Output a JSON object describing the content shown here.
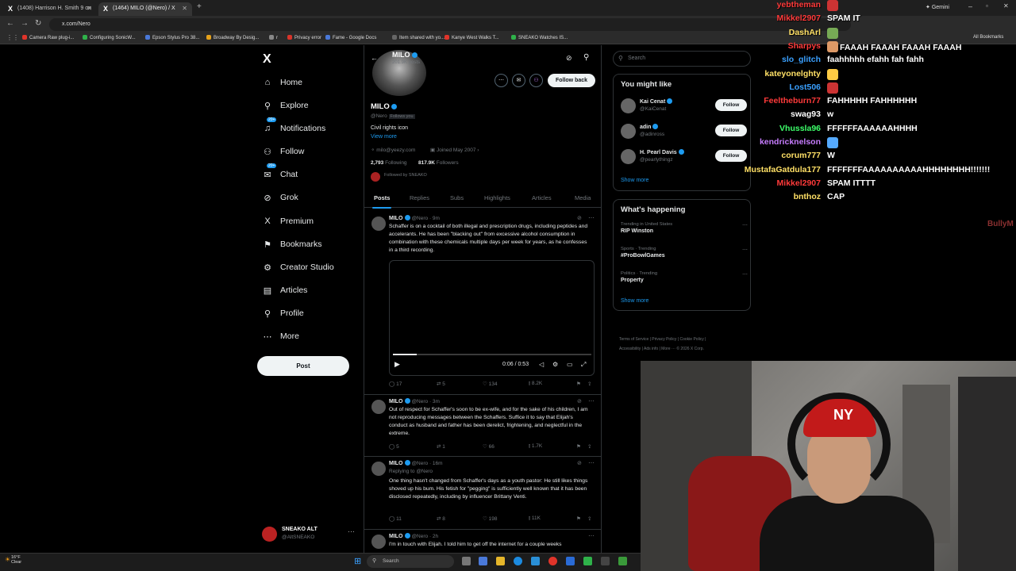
{
  "browser": {
    "tabs": [
      {
        "title": "(1408) Harrison H. Smith 9 on"
      },
      {
        "title": "(1464) MILO (@Nero) / X"
      }
    ],
    "new_tab_icon": "+",
    "url": "x.com/Nero",
    "gemini_label": "Gemini",
    "bookmarks": [
      {
        "label": "Camera Raw plug-i...",
        "color": "#e0342a"
      },
      {
        "label": "Configuring SonicW...",
        "color": "#2fb24a"
      },
      {
        "label": "Epson Stylus Pro 38...",
        "color": "#4a79d9"
      },
      {
        "label": "Broadway By Desig...",
        "color": "#e6a21a"
      },
      {
        "label": "r",
        "color": "#888888"
      },
      {
        "label": "Privacy error",
        "color": "#d9342a"
      },
      {
        "label": "Fame - Google Docs",
        "color": "#4a79d9"
      },
      {
        "label": "Item shared with yo...",
        "color": "#666666"
      },
      {
        "label": "Kanye West Walks T...",
        "color": "#e0342a"
      },
      {
        "label": "SNEAKO Watches IS...",
        "color": "#2fb24a"
      }
    ],
    "all_bookmarks": "All Bookmarks"
  },
  "nav": {
    "items": [
      {
        "label": "Home",
        "icon": "home-icon",
        "glyph": "⌂"
      },
      {
        "label": "Explore",
        "icon": "search-icon",
        "glyph": "⚲"
      },
      {
        "label": "Notifications",
        "icon": "bell-icon",
        "glyph": "♫",
        "badge": "20+"
      },
      {
        "label": "Follow",
        "icon": "add-user-icon",
        "glyph": "⚇"
      },
      {
        "label": "Chat",
        "icon": "mail-icon",
        "glyph": "✉",
        "badge": "20+"
      },
      {
        "label": "Grok",
        "icon": "grok-icon",
        "glyph": "⊘"
      },
      {
        "label": "Premium",
        "icon": "x-icon",
        "glyph": "X"
      },
      {
        "label": "Bookmarks",
        "icon": "bookmark-icon",
        "glyph": "⚑"
      },
      {
        "label": "Creator Studio",
        "icon": "studio-icon",
        "glyph": "⚙"
      },
      {
        "label": "Articles",
        "icon": "articles-icon",
        "glyph": "▤"
      },
      {
        "label": "Profile",
        "icon": "person-icon",
        "glyph": "⚲"
      },
      {
        "label": "More",
        "icon": "more-icon",
        "glyph": "⋯"
      }
    ],
    "post_label": "Post",
    "account": {
      "name": "SNEAKO ALT",
      "handle": "@AltSNEAKO"
    }
  },
  "profile": {
    "header_name": "MILO",
    "header_posts": "201.9K posts",
    "name": "MILO",
    "handle": "@Nero",
    "follows_you": "Follows you",
    "bio": "Civil rights icon",
    "view_more": "View more",
    "email": "milo@yeezy.com",
    "joined": "Joined May 2007",
    "following_count": "2,793",
    "following_label": "Following",
    "followers_count": "817.9K",
    "followers_label": "Followers",
    "followed_by": "Followed by SNEAKO",
    "follow_back": "Follow back",
    "tabs": [
      "Posts",
      "Replies",
      "Subs",
      "Highlights",
      "Articles",
      "Media"
    ]
  },
  "tweets": [
    {
      "name": "MILO",
      "handle": "@Nero",
      "time": "9m",
      "reply_to": "",
      "text": "Schaffer is on a cocktail of both illegal and prescription drugs, including peptides and accelerants. He has been \"blacking out\" from excessive alcohol consumption in combination with these chemicals multiple days per week for years, as he confesses in a third recording.",
      "video_time": "0:06 / 0:53",
      "replies": "17",
      "reposts": "5",
      "likes": "134",
      "views": "8.2K"
    },
    {
      "name": "MILO",
      "handle": "@Nero",
      "time": "3m",
      "reply_to": "",
      "text": "Out of respect for Schaffer's soon to be ex-wife, and for the sake of his children, I am not reproducing messages between the Schaffers. Suffice it to say that Elijah's conduct as husband and father has been derelict, frightening, and neglectful in the extreme.",
      "replies": "5",
      "reposts": "1",
      "likes": "66",
      "views": "1.7K"
    },
    {
      "name": "MILO",
      "handle": "@Nero",
      "time": "16m",
      "reply_to": "Replying to @Nero",
      "text": "One thing hasn't changed from Schaffer's days as a youth pastor: He still likes things shoved up his bum. His fetish for \"pegging\" is sufficiently well known that it has been disclosed repeatedly, including by influencer Brittany Venti.",
      "replies": "11",
      "reposts": "8",
      "likes": "198",
      "views": "11K"
    },
    {
      "name": "MILO",
      "handle": "@Nero",
      "time": "2h",
      "reply_to": "",
      "text": "I'm in touch with Elijah. I told him to get off the internet for a couple weeks"
    }
  ],
  "sidebar": {
    "search_placeholder": "Search",
    "you_might_like": "You might like",
    "suggestions": [
      {
        "name": "Kai Cenat",
        "handle": "@KaiCenat",
        "follow": "Follow"
      },
      {
        "name": "adin",
        "handle": "@adinross",
        "follow": "Follow"
      },
      {
        "name": "H. Pearl Davis",
        "handle": "@pearlythingz",
        "follow": "Follow"
      }
    ],
    "show_more": "Show more",
    "whats_happening": "What's happening",
    "trends": [
      {
        "category": "Trending in United States",
        "title": "RIP Winston"
      },
      {
        "category": "Sports · Trending",
        "title": "#ProBowlGames"
      },
      {
        "category": "Politics · Trending",
        "title": "Property"
      }
    ],
    "footer1": "Terms of Service  |  Privacy Policy  |  Cookie Policy  |",
    "footer2": "Accessibility  |  Ads info  |  More ···  © 2026 X Corp."
  },
  "chat": [
    {
      "user": "yebtheman",
      "color": "#ff3a3a",
      "msg": ""
    },
    {
      "user": "Mikkel2907",
      "color": "#ff3a3a",
      "msg": "SPAM IT"
    },
    {
      "user": "DashArl",
      "color": "#ffe066",
      "msg": ""
    },
    {
      "user": "Sharpys",
      "color": "#ff3a3a",
      "msg": "FAAAH   FAAAH   FAAAH   FAAAH"
    },
    {
      "user": "slo_glitch",
      "color": "#3aa0ff",
      "msg": "faahhhhh efahh fah fahh"
    },
    {
      "user": "kateyonelghty",
      "color": "#ffe066",
      "msg": ""
    },
    {
      "user": "Lost506",
      "color": "#3aa0ff",
      "msg": ""
    },
    {
      "user": "Feeltheburn77",
      "color": "#ff3a3a",
      "msg": "FAHHHHH FAHHHHHH"
    },
    {
      "user": "swag93",
      "color": "#ffffff",
      "msg": "w"
    },
    {
      "user": "Vhussla96",
      "color": "#3dff6a",
      "msg": "FFFFFFAAAAAAHHHH"
    },
    {
      "user": "kendricknelson",
      "color": "#c77dff",
      "msg": ""
    },
    {
      "user": "corum777",
      "color": "#ffe066",
      "msg": "W"
    },
    {
      "user": "MustafaGatdula177",
      "color": "#ffe066",
      "msg": "FFFFFFFAAAAAAAAAAHHHHHHHH!!!!!!!"
    },
    {
      "user": "Mikkel2907",
      "color": "#ff3a3a",
      "msg": "SPAM ITTTT"
    },
    {
      "user": "bnthoz",
      "color": "#ffe066",
      "msg": "CAP"
    }
  ],
  "chat_partial": "BullyM",
  "taskbar": {
    "weather_temp": "16°F",
    "weather_desc": "Clear",
    "search_placeholder": "Search"
  }
}
